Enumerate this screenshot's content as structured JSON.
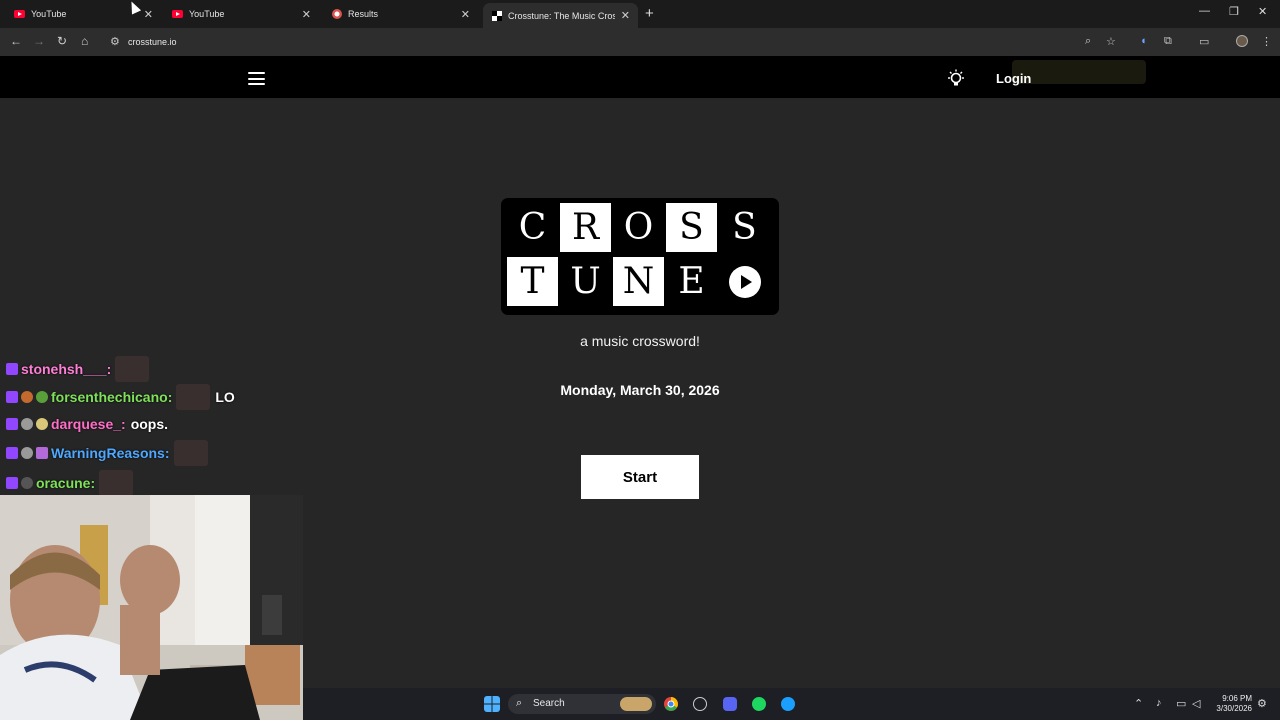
{
  "browser": {
    "tabs": [
      {
        "title": "YouTube",
        "active": false
      },
      {
        "title": "YouTube",
        "active": false
      },
      {
        "title": "Results",
        "active": false
      },
      {
        "title": "Crosstune: The Music Crossword",
        "active": true
      }
    ],
    "url": "crosstune.io"
  },
  "site": {
    "login_label": "Login",
    "logo_row1": [
      "C",
      "R",
      "O",
      "S",
      "S"
    ],
    "logo_row2": [
      "T",
      "U",
      "N",
      "E"
    ],
    "tagline": "a music crossword!",
    "date": "Monday, March 30, 2026",
    "start_label": "Start"
  },
  "chat": [
    {
      "user": "stonehsh___:",
      "color": "#ff7fd6",
      "message": ""
    },
    {
      "user": "forsenthechicano:",
      "color": "#7fe05a",
      "message": "LO"
    },
    {
      "user": "darquese_:",
      "color": "#ff6fc8",
      "message": "oops."
    },
    {
      "user": "WarningReasons:",
      "color": "#4fa8ff",
      "message": ""
    },
    {
      "user": "oracune:",
      "color": "#7fe05a",
      "message": ""
    }
  ],
  "taskbar": {
    "search_label": "Search",
    "time": "9:06 PM",
    "date": "3/30/2026"
  },
  "colors": {
    "page_bg": "#262626",
    "header_bg": "#000000",
    "twitch_purple": "#9146ff"
  }
}
